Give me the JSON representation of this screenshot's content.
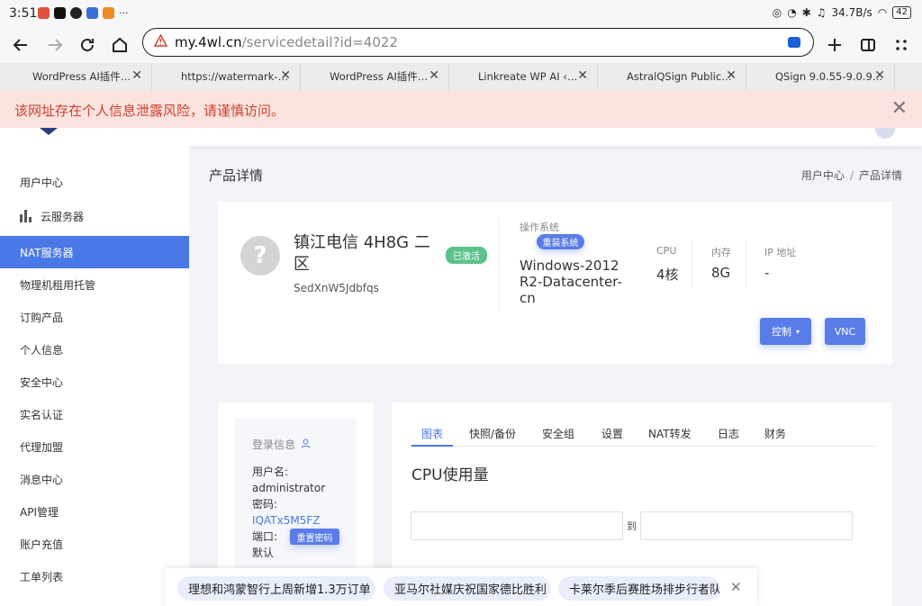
{
  "status_bar": {
    "time": "3:51",
    "more": "···",
    "net_speed": "34.7B/s",
    "battery": "42",
    "app_icons": [
      "app-icon-red",
      "tiktok-icon",
      "qq-icon",
      "app-icon-blue",
      "app-icon-orange"
    ]
  },
  "browser": {
    "url_host": "my.4wl.cn",
    "url_path": "/servicedetail?id=4022",
    "tabs": [
      "WordPress AI插件…",
      "https://watermark-…",
      "WordPress AI插件…",
      "Linkreate WP AI ‹…",
      "AstralQSign Public…",
      "QSign 9.0.55-9.0.9…"
    ],
    "warning": "该网址存在个人信息泄露风险，请谨慎访问。"
  },
  "sidebar": {
    "items": [
      {
        "label": "用户中心"
      },
      {
        "label": "云服务器"
      },
      {
        "label": "NAT服务器"
      },
      {
        "label": "物理机租用托管"
      },
      {
        "label": "订购产品"
      },
      {
        "label": "个人信息"
      },
      {
        "label": "安全中心"
      },
      {
        "label": "实名认证"
      },
      {
        "label": "代理加盟"
      },
      {
        "label": "消息中心"
      },
      {
        "label": "API管理"
      },
      {
        "label": "账户充值"
      },
      {
        "label": "工单列表"
      }
    ]
  },
  "page": {
    "title": "产品详情",
    "breadcrumb": [
      "用户中心",
      "产品详情"
    ],
    "breadcrumb_sep": "/"
  },
  "product": {
    "name": "镇江电信 4H8G 二区",
    "status": "已激活",
    "code": "SedXnW5Jdbfqs",
    "os_label": "操作系统",
    "reinstall_btn": "重装系统",
    "os_value": "Windows-2012R2-Datacenter-cn",
    "cpu_label": "CPU",
    "cpu_value": "4核",
    "mem_label": "内存",
    "mem_value": "8G",
    "ip_label": "IP 地址",
    "ip_value": "-",
    "control_btn": "控制",
    "vnc_btn": "VNC"
  },
  "login": {
    "title": "登录信息",
    "username_label": "用户名:",
    "username": "administrator",
    "password_label": "密码:",
    "password": "IQATx5M5FZ",
    "port_label": "端口:",
    "port": "默认",
    "reset_btn": "重置密码"
  },
  "tabs_panel": {
    "tabs": [
      "图表",
      "快照/备份",
      "安全组",
      "设置",
      "NAT转发",
      "日志",
      "财务"
    ],
    "active": "图表",
    "chart_title": "CPU使用量",
    "range_to": "到",
    "start_value": "",
    "end_value": ""
  },
  "news": {
    "items": [
      "理想和鸿蒙智行上周新增1.3万订单",
      "亚马尔社媒庆祝国家德比胜利",
      "卡莱尔季后赛胜场排步行者队"
    ]
  },
  "colors": {
    "accent": "#4a78e6",
    "warning_bg": "#fbe3df",
    "warning_text": "#d1412f",
    "success": "#5cc28b"
  }
}
